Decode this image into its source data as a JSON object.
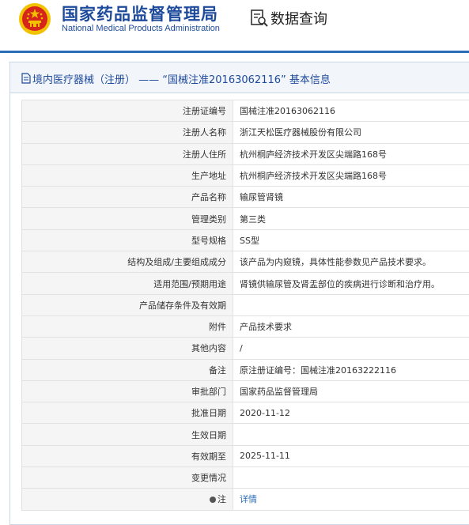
{
  "header": {
    "org_name_cn": "国家药品监督管理局",
    "org_name_en": "National Medical Products Administration",
    "query_label": "数据查询",
    "emblem_icon": "national-emblem-icon",
    "query_icon": "document-search-icon"
  },
  "panel": {
    "title": "境内医疗器械（注册） ——  “国械注准20163062116” 基本信息",
    "title_icon": "document-icon"
  },
  "rows": [
    {
      "label": "注册证编号",
      "value": "国械注准20163062116"
    },
    {
      "label": "注册人名称",
      "value": "浙江天松医疗器械股份有限公司"
    },
    {
      "label": "注册人住所",
      "value": "杭州桐庐经济技术开发区尖端路168号"
    },
    {
      "label": "生产地址",
      "value": "杭州桐庐经济技术开发区尖端路168号"
    },
    {
      "label": "产品名称",
      "value": "输尿管肾镜"
    },
    {
      "label": "管理类别",
      "value": "第三类"
    },
    {
      "label": "型号规格",
      "value": "SS型"
    },
    {
      "label": "结构及组成/主要组成成分",
      "value": "该产品为内窥镜，具体性能参数见产品技术要求。"
    },
    {
      "label": "适用范围/预期用途",
      "value": "肾镜供输尿管及肾盂部位的疾病进行诊断和治疗用。"
    },
    {
      "label": "产品储存条件及有效期",
      "value": ""
    },
    {
      "label": "附件",
      "value": "产品技术要求"
    },
    {
      "label": "其他内容",
      "value": "/"
    },
    {
      "label": "备注",
      "value": "原注册证编号：国械注准20163222116"
    },
    {
      "label": "审批部门",
      "value": "国家药品监督管理局"
    },
    {
      "label": "批准日期",
      "value": "2020-11-12"
    },
    {
      "label": "生效日期",
      "value": ""
    },
    {
      "label": "有效期至",
      "value": "2025-11-11"
    },
    {
      "label": "变更情况",
      "value": ""
    }
  ],
  "note_row": {
    "label": "注",
    "icon": "pin-icon",
    "link_text": "详情"
  },
  "colors": {
    "brand_blue": "#1e4a9c",
    "link_blue": "#2b6cb8",
    "emblem_red": "#d6261c",
    "emblem_gold": "#f2c200"
  }
}
